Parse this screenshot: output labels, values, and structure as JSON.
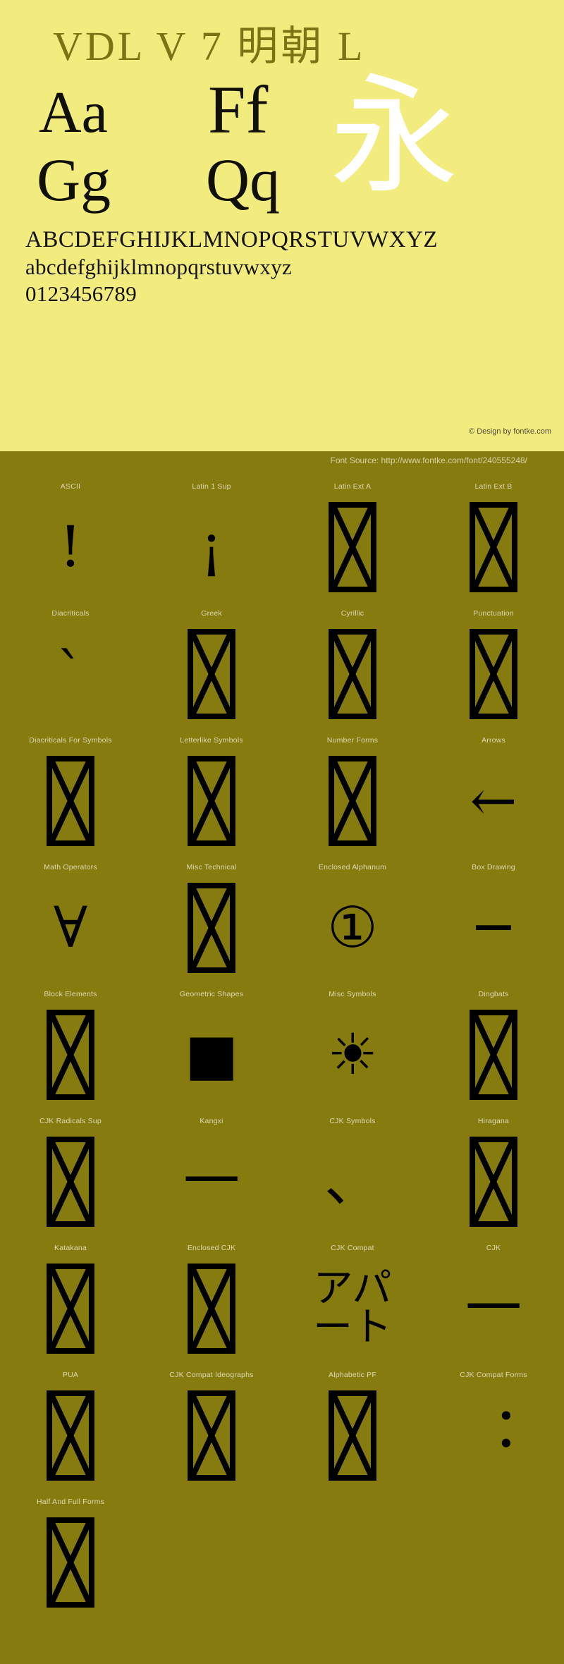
{
  "colors": {
    "header_bg": "#f2ec7f",
    "body_bg": "#867b0f",
    "title_color": "#7d7214",
    "glyph_black": "#111008",
    "glyph_white": "#ffffff",
    "label_color": "#ded9b3",
    "source_color": "#d8d2a5",
    "copyright_color": "#4d4a36"
  },
  "header": {
    "title": "VDL V 7 明朝 L",
    "pairs": [
      {
        "name": "aa",
        "text": "Aa"
      },
      {
        "name": "ff",
        "text": "Ff"
      },
      {
        "name": "gg",
        "text": "Gg"
      },
      {
        "name": "qq",
        "text": "Qq"
      }
    ],
    "cjk_sample": "永",
    "uppercase": "ABCDEFGHIJKLMNOPQRSTUVWXYZ",
    "lowercase": "abcdefghijklmnopqrstuvwxyz",
    "digits": "0123456789",
    "copyright": "© Design by fontke.com"
  },
  "source_bar": {
    "text": "Font Source: http://www.fontke.com/font/240555248/"
  },
  "blocks": [
    {
      "label": "ASCII",
      "sample": "!",
      "type": "glyph"
    },
    {
      "label": "Latin 1 Sup",
      "sample": "¡",
      "type": "glyph"
    },
    {
      "label": "Latin Ext A",
      "sample": "",
      "type": "tofu"
    },
    {
      "label": "Latin Ext B",
      "sample": "",
      "type": "tofu"
    },
    {
      "label": "Diacriticals",
      "sample": "ˋ",
      "type": "glyph"
    },
    {
      "label": "Greek",
      "sample": "",
      "type": "tofu"
    },
    {
      "label": "Cyrillic",
      "sample": "",
      "type": "tofu"
    },
    {
      "label": "Punctuation",
      "sample": "",
      "type": "tofu"
    },
    {
      "label": "Diacriticals For Symbols",
      "sample": "",
      "type": "tofu"
    },
    {
      "label": "Letterlike Symbols",
      "sample": "",
      "type": "tofu"
    },
    {
      "label": "Number Forms",
      "sample": "",
      "type": "tofu"
    },
    {
      "label": "Arrows",
      "sample": "←",
      "type": "glyph"
    },
    {
      "label": "Math Operators",
      "sample": "∀",
      "type": "glyph"
    },
    {
      "label": "Misc Technical",
      "sample": "",
      "type": "tofu"
    },
    {
      "label": "Enclosed Alphanum",
      "sample": "①",
      "type": "glyph"
    },
    {
      "label": "Box Drawing",
      "sample": "─",
      "type": "glyph"
    },
    {
      "label": "Block Elements",
      "sample": "",
      "type": "tofu"
    },
    {
      "label": "Geometric Shapes",
      "sample": "■",
      "type": "glyph"
    },
    {
      "label": "Misc Symbols",
      "sample": "☀",
      "type": "glyph"
    },
    {
      "label": "Dingbats",
      "sample": "",
      "type": "tofu"
    },
    {
      "label": "CJK Radicals Sup",
      "sample": "",
      "type": "tofu"
    },
    {
      "label": "Kangxi",
      "sample": "⼀",
      "type": "glyph"
    },
    {
      "label": "CJK Symbols",
      "sample": "、",
      "type": "glyph"
    },
    {
      "label": "Hiragana",
      "sample": "",
      "type": "tofu"
    },
    {
      "label": "Katakana",
      "sample": "",
      "type": "tofu"
    },
    {
      "label": "Enclosed CJK",
      "sample": "",
      "type": "tofu"
    },
    {
      "label": "CJK Compat",
      "sample": "アパート",
      "type": "katakana"
    },
    {
      "label": "CJK",
      "sample": "一",
      "type": "glyph"
    },
    {
      "label": "PUA",
      "sample": "",
      "type": "tofu"
    },
    {
      "label": "CJK Compat Ideographs",
      "sample": "",
      "type": "tofu"
    },
    {
      "label": "Alphabetic PF",
      "sample": "",
      "type": "tofu"
    },
    {
      "label": "CJK Compat Forms",
      "sample": "︓",
      "type": "glyph"
    },
    {
      "label": "Half And Full Forms",
      "sample": "",
      "type": "tofu"
    }
  ]
}
